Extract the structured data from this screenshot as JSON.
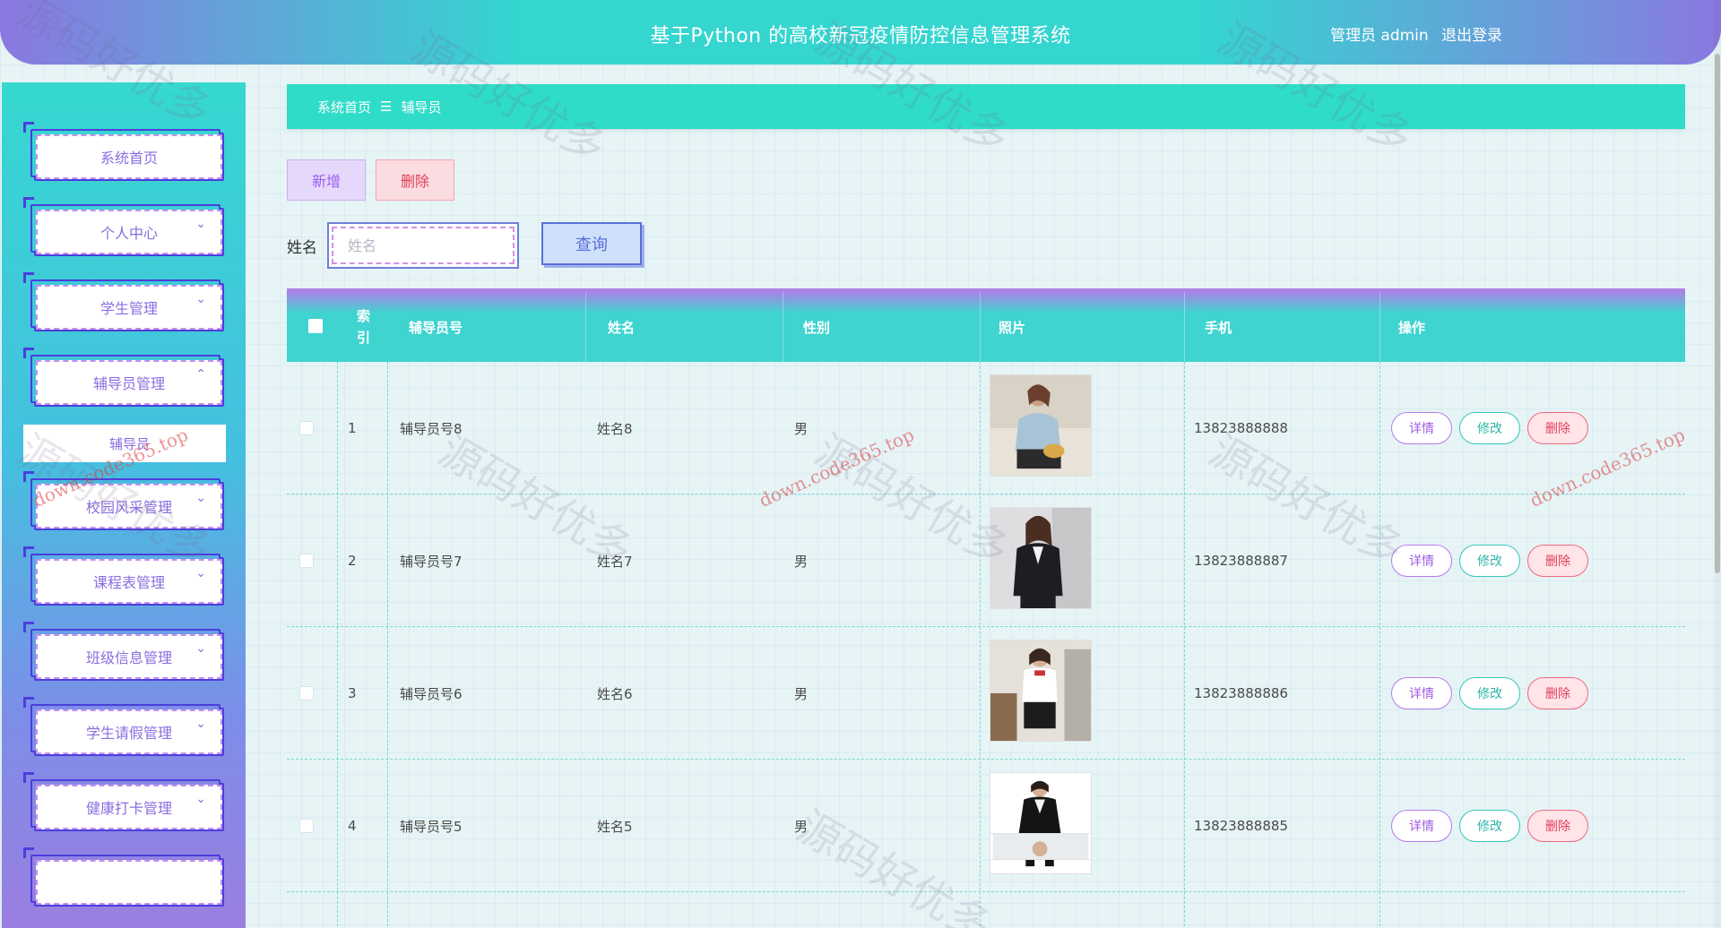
{
  "header": {
    "title": "基于Python 的高校新冠疫情防控信息管理系统",
    "user": "管理员 admin",
    "logout": "退出登录"
  },
  "sidebar": {
    "items": [
      {
        "label": "系统首页",
        "has_chevron": false
      },
      {
        "label": "个人中心",
        "has_chevron": true
      },
      {
        "label": "学生管理",
        "has_chevron": true
      },
      {
        "label": "辅导员管理",
        "has_chevron": true,
        "expanded": true
      },
      {
        "label": "校园风采管理",
        "has_chevron": true
      },
      {
        "label": "课程表管理",
        "has_chevron": true
      },
      {
        "label": "班级信息管理",
        "has_chevron": true
      },
      {
        "label": "学生请假管理",
        "has_chevron": true
      },
      {
        "label": "健康打卡管理",
        "has_chevron": true
      }
    ],
    "submenu_active": "辅导员"
  },
  "breadcrumb": {
    "home": "系统首页",
    "separator": "☰",
    "current": "辅导员"
  },
  "actions": {
    "add": "新增",
    "delete": "删除"
  },
  "search": {
    "label": "姓名",
    "placeholder": "姓名",
    "button": "查询"
  },
  "table": {
    "headers": {
      "index": "索引",
      "counselor_no": "辅导员号",
      "name": "姓名",
      "gender": "性别",
      "photo": "照片",
      "phone": "手机",
      "ops": "操作"
    },
    "rows": [
      {
        "index": "1",
        "counselor_no": "辅导员号8",
        "name": "姓名8",
        "gender": "男",
        "phone": "13823888888"
      },
      {
        "index": "2",
        "counselor_no": "辅导员号7",
        "name": "姓名7",
        "gender": "男",
        "phone": "13823888887"
      },
      {
        "index": "3",
        "counselor_no": "辅导员号6",
        "name": "姓名6",
        "gender": "男",
        "phone": "13823888886"
      },
      {
        "index": "4",
        "counselor_no": "辅导员号5",
        "name": "姓名5",
        "gender": "男",
        "phone": "13823888885"
      }
    ],
    "row_actions": {
      "detail": "详情",
      "edit": "修改",
      "remove": "删除"
    }
  },
  "watermarks": {
    "brand": "源码好优多",
    "url": "down.code365.top"
  },
  "colors": {
    "teal": "#2fdcc8",
    "purple": "#a984e6",
    "accent_blue": "#4a3fdc",
    "danger": "#e0405a"
  }
}
